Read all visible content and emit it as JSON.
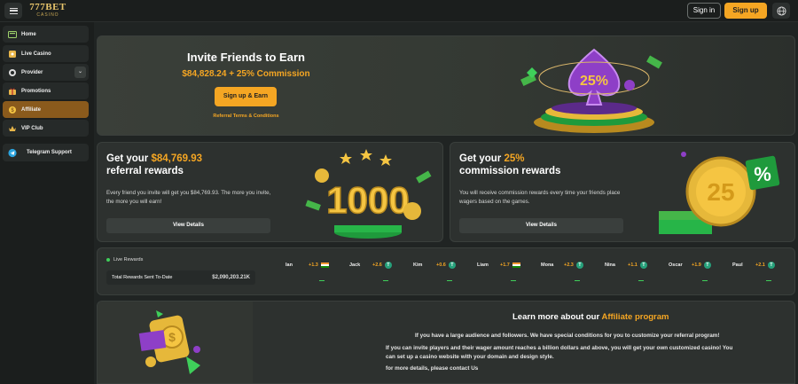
{
  "header": {
    "logo_main": "777BET",
    "logo_sub": "CASINO",
    "signin_label": "Sign in",
    "signup_label": "Sign up",
    "menu_icon": "hamburger-icon",
    "globe_icon": "globe-icon"
  },
  "sidebar": {
    "items": [
      {
        "label": "Home",
        "icon": "home-icon"
      },
      {
        "label": "Live Casino",
        "icon": "live-casino-icon"
      },
      {
        "label": "Provider",
        "icon": "provider-icon"
      },
      {
        "label": "Promotions",
        "icon": "promotions-icon"
      },
      {
        "label": "Affiliate",
        "icon": "affiliate-icon"
      },
      {
        "label": "VIP Club",
        "icon": "vip-icon"
      },
      {
        "label": "Telegram Support",
        "icon": "telegram-icon"
      }
    ]
  },
  "hero": {
    "title": "Invite Friends to Earn",
    "amount": "$84,828.24 + 25% Commission",
    "button": "Sign up & Earn",
    "link": "Referral Terms & Conditions"
  },
  "referral": {
    "title_pre": "Get your ",
    "title_amount": "$84,769.93",
    "title_post": "referral rewards",
    "desc": "Every friend you invite will get you $84,769.93. The more you invite, the more you will earn!",
    "button": "View Details",
    "badge": "1000"
  },
  "commission": {
    "title_pre": "Get your ",
    "title_amount": "25%",
    "title_post": "commission rewards",
    "desc": "You will receive commission rewards every time your friends place wagers based on the games.",
    "button": "View Details",
    "badge": "25"
  },
  "live": {
    "label": "Live Rewards",
    "total_label": "Total Rewards Sent To-Date",
    "total_value": "$2,090,203.21K",
    "ticker": [
      {
        "name": "Ian",
        "value": "+1.3",
        "icon": "india-flag"
      },
      {
        "name": "Jack",
        "value": "+2.6",
        "icon": "tether-coin"
      },
      {
        "name": "Kim",
        "value": "+0.6",
        "icon": "tether-coin"
      },
      {
        "name": "Liam",
        "value": "+1.7",
        "icon": "india-flag"
      },
      {
        "name": "Mona",
        "value": "+2.3",
        "icon": "tether-coin"
      },
      {
        "name": "Nina",
        "value": "+1.1",
        "icon": "tether-coin"
      },
      {
        "name": "Oscar",
        "value": "+1.9",
        "icon": "tether-coin"
      },
      {
        "name": "Paul",
        "value": "+2.1",
        "icon": "tether-coin"
      }
    ]
  },
  "affiliate": {
    "title_pre": "Learn more about our ",
    "title_hl": "Affiliate program",
    "line1": "If you have a large audience and followers. We have special conditions for you to customize your referral program!",
    "line2": "If you can invite players and their wager amount reaches a billion dollars and above, you will get your own customized casino! You",
    "line3": "can set up a casino website with your domain and design style.",
    "line4": "for more details, please contact Us"
  },
  "colors": {
    "accent": "#f5a623",
    "active_nav": "#8a5a1c",
    "live_dot": "#3fcf5a",
    "tether": "#26a17b"
  }
}
